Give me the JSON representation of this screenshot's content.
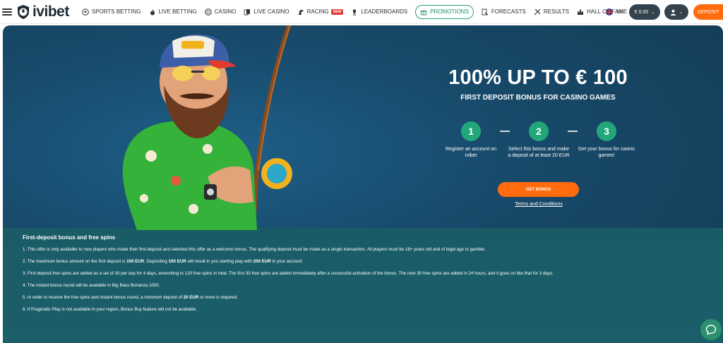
{
  "brand": {
    "name": "ivibet"
  },
  "nav": {
    "items": [
      {
        "label": "SPORTS BETTING",
        "icon": "soccer-ball-icon"
      },
      {
        "label": "LIVE BETTING",
        "icon": "fire-icon"
      },
      {
        "label": "CASINO",
        "icon": "chip-icon"
      },
      {
        "label": "LIVE CASINO",
        "icon": "live-cards-icon"
      },
      {
        "label": "RACING",
        "icon": "horse-icon",
        "badge": "NEW"
      },
      {
        "label": "LEADERBOARDS",
        "icon": "trophy-icon"
      },
      {
        "label": "PROMOTIONS",
        "icon": "gift-icon",
        "active": true
      },
      {
        "label": "FORECASTS",
        "icon": "forecast-icon"
      },
      {
        "label": "RESULTS",
        "icon": "results-icon"
      },
      {
        "label": "HALL OF FAME",
        "icon": "castle-icon"
      }
    ]
  },
  "header": {
    "lang": "EN",
    "balance": "€ 0.00",
    "deposit": "DEPOSIT"
  },
  "offer": {
    "title": "100% UP TO € 100",
    "subtitle": "FIRST DEPOSIT BONUS FOR CASINO GAMES",
    "steps": [
      {
        "num": "1",
        "text": "Register an account on Ivibet"
      },
      {
        "num": "2",
        "text": "Select this bonus and make a deposit of at least 20 EUR"
      },
      {
        "num": "3",
        "text": "Get your bonus for casino games!"
      }
    ],
    "cta": "GET BONUS",
    "terms": "Terms and Conditions"
  },
  "rules": {
    "heading": "First-deposit bonus and free spins",
    "r1": "1. This offer is only available to new players who made their first deposit and selected this offer as a welcome bonus. The qualifying deposit must be made as a single transaction. All players must be 18+ years old and of legal age to gamble.",
    "r2a": "2. The maximum bonus amount on the first deposit is ",
    "r2b": "100 EUR",
    "r2c": ". Depositing ",
    "r2d": "100 EUR",
    "r2e": " will result in you starting play with ",
    "r2f": "200 EUR",
    "r2g": " in your account.",
    "r3": "3. First deposit free spins are added as a set of 30 per day for 4 days, amounting to 120 free spins in total. The first 30 free spins are added immediately after a successful activation of the bonus. The next 30 free spins are added in 24 hours, and it goes on like that for 3 days.",
    "r4": "4. The instant bonus round will be available in Big Bass Bonanza 1000.",
    "r5a": "5. In order to receive the free spins and instant bonus round, a minimum deposit of ",
    "r5b": "20 EUR",
    "r5c": " or more is required.",
    "r6": "6. If Pragmatic Play is not available in your region, Bonus Buy feature will not be available."
  },
  "colors": {
    "accent": "#ff6b0d",
    "step_green": "#21a77a",
    "hero_bg": "#184a6b",
    "rules_bg": "#1a5b66"
  }
}
